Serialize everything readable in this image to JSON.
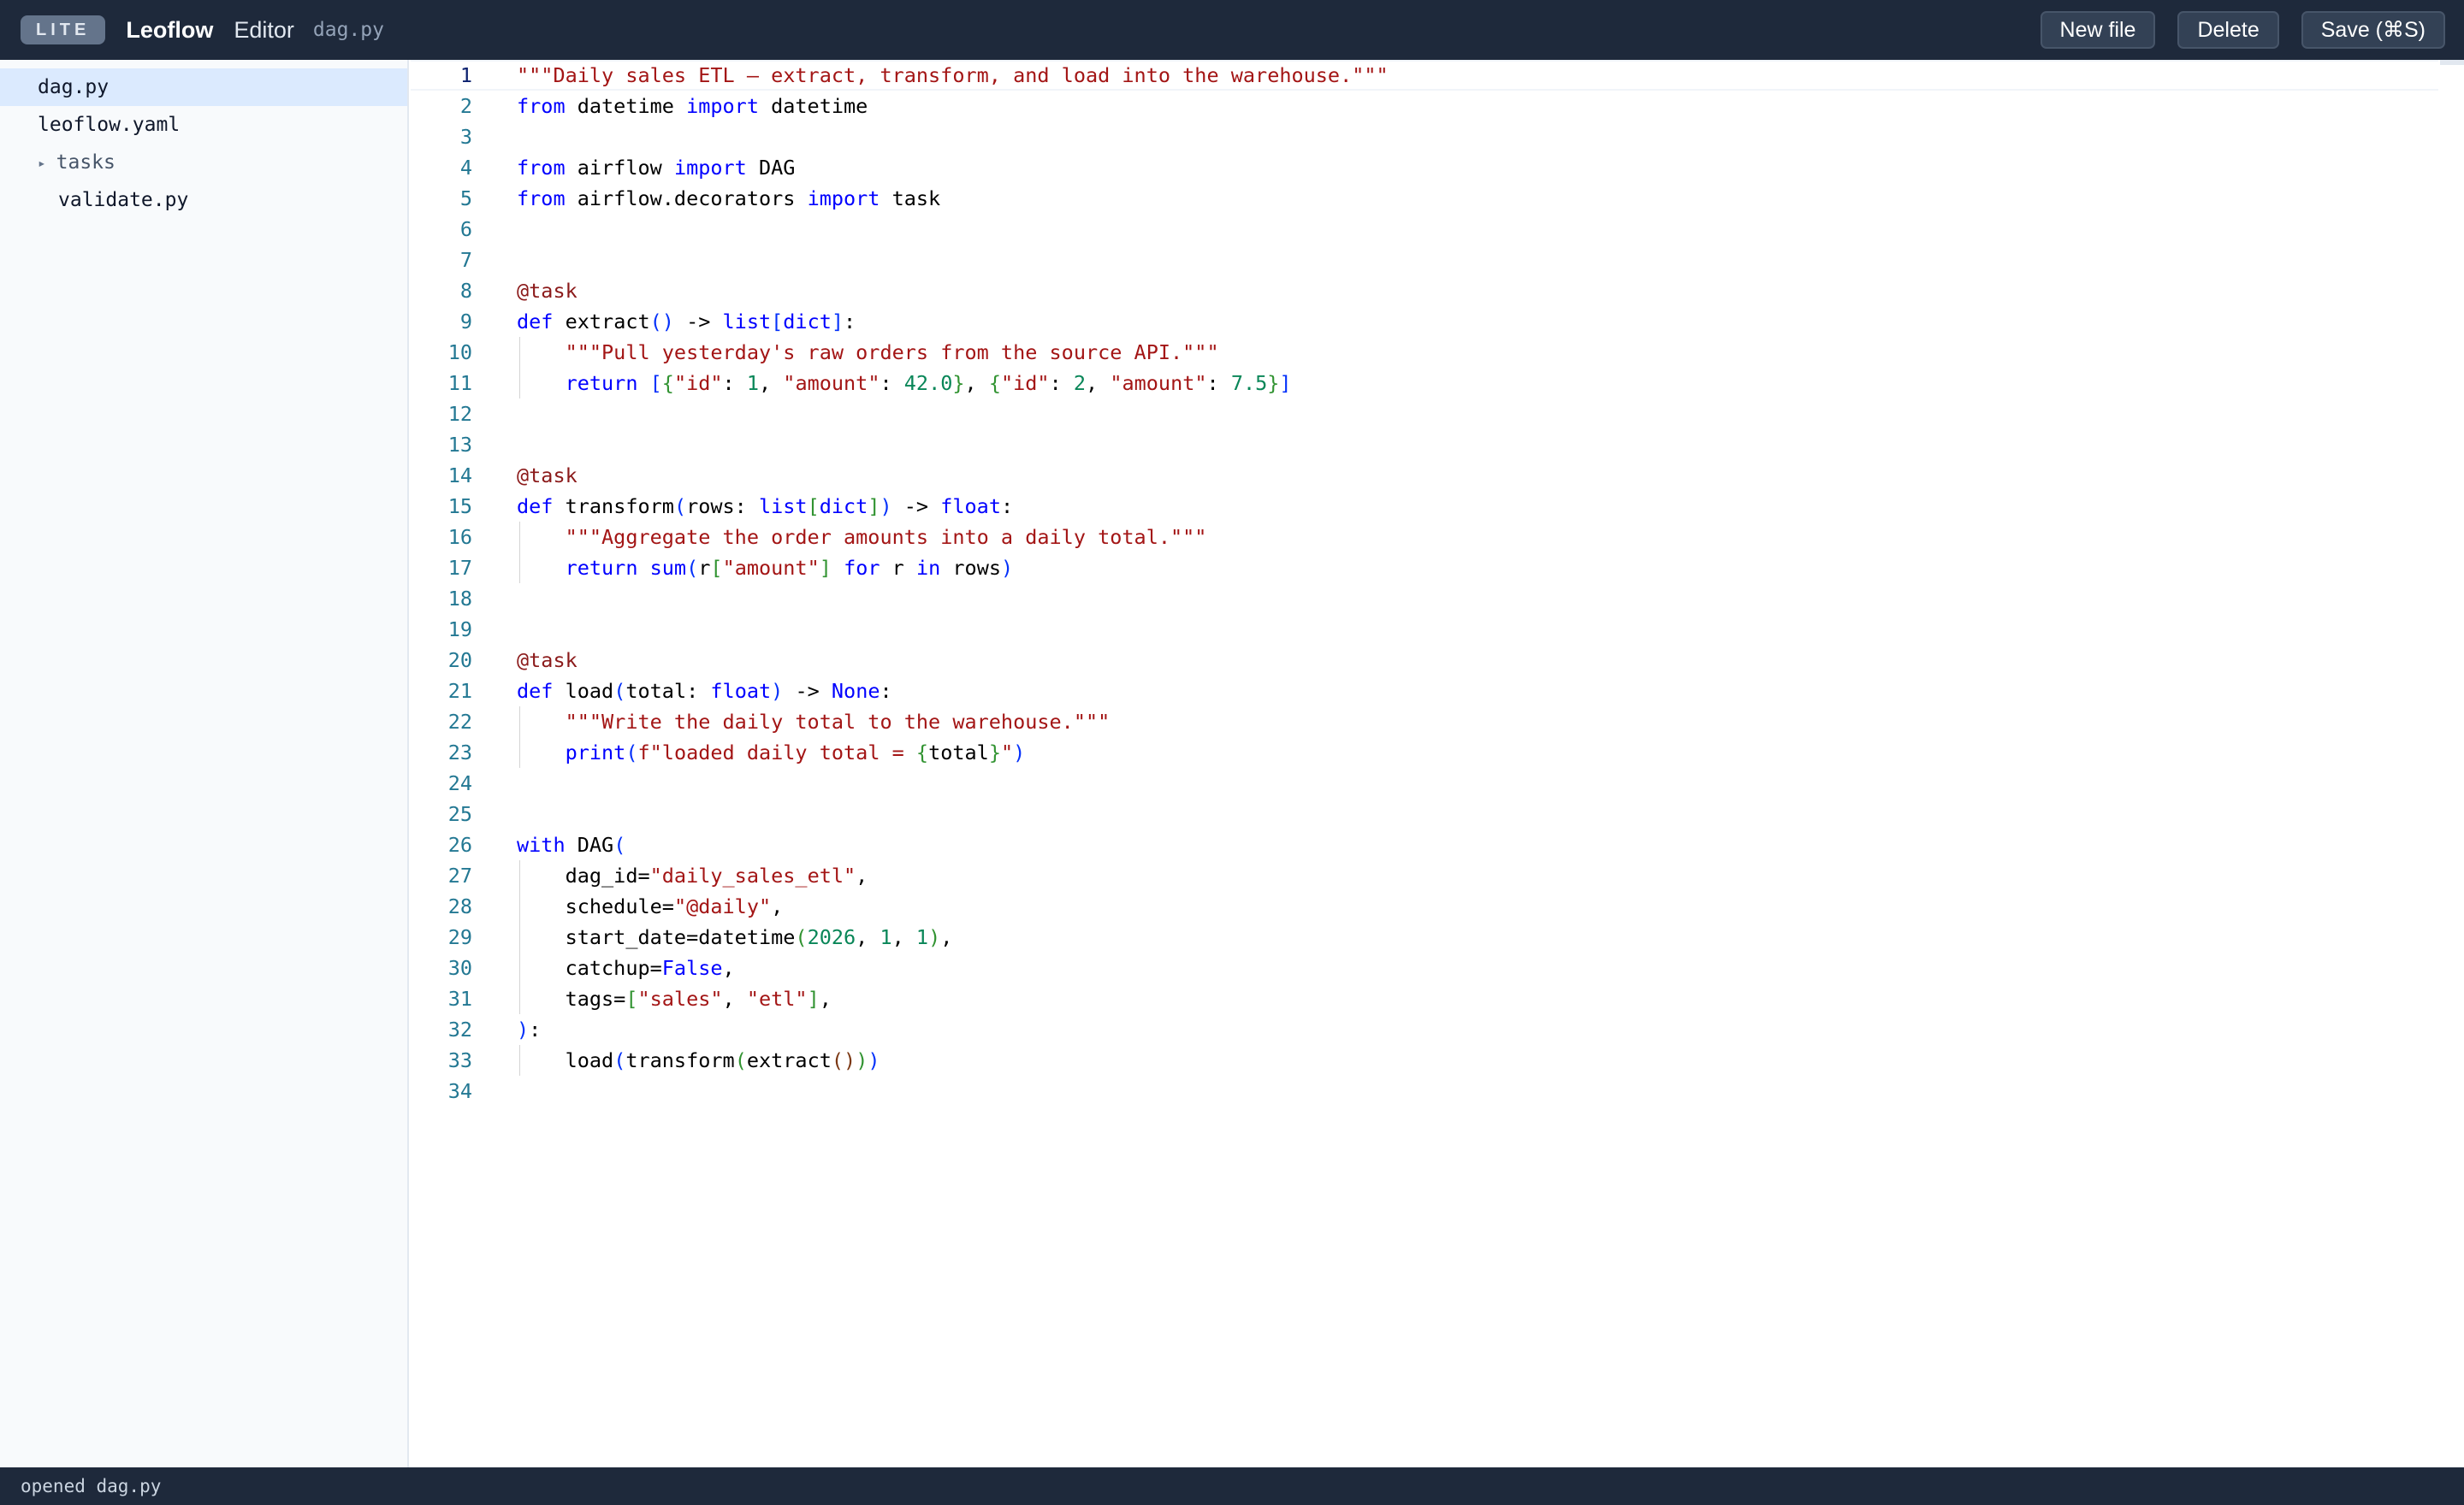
{
  "header": {
    "badge": "LITE",
    "app_name": "Leoflow",
    "section": "Editor",
    "current_file": "dag.py",
    "buttons": {
      "new_file": "New file",
      "delete": "Delete",
      "save": "Save (⌘S)"
    }
  },
  "sidebar": {
    "items": [
      {
        "label": "dag.py",
        "type": "file",
        "active": true,
        "depth": 0
      },
      {
        "label": "leoflow.yaml",
        "type": "file",
        "active": false,
        "depth": 0
      },
      {
        "label": "tasks",
        "type": "folder",
        "active": false,
        "depth": 0,
        "icon": "caret-right-icon"
      },
      {
        "label": "validate.py",
        "type": "file",
        "active": false,
        "depth": 1
      }
    ]
  },
  "editor": {
    "active_line": 1,
    "lines": [
      [
        [
          "str",
          "\"\"\"Daily sales ETL — extract, transform, and load into the warehouse.\"\"\""
        ]
      ],
      [
        [
          "kw",
          "from"
        ],
        [
          "p",
          " datetime "
        ],
        [
          "kw",
          "import"
        ],
        [
          "p",
          " datetime"
        ]
      ],
      [],
      [
        [
          "kw",
          "from"
        ],
        [
          "p",
          " airflow "
        ],
        [
          "kw",
          "import"
        ],
        [
          "p",
          " DAG"
        ]
      ],
      [
        [
          "kw",
          "from"
        ],
        [
          "p",
          " airflow.decorators "
        ],
        [
          "kw",
          "import"
        ],
        [
          "p",
          " task"
        ]
      ],
      [],
      [],
      [
        [
          "dec",
          "@task"
        ]
      ],
      [
        [
          "kw",
          "def"
        ],
        [
          "p",
          " extract"
        ],
        [
          "b1",
          "()"
        ],
        [
          "p",
          " -> "
        ],
        [
          "kw",
          "list"
        ],
        [
          "b1",
          "["
        ],
        [
          "kw",
          "dict"
        ],
        [
          "b1",
          "]"
        ],
        [
          "p",
          ":"
        ]
      ],
      [
        [
          "p",
          "    "
        ],
        [
          "str",
          "\"\"\"Pull yesterday's raw orders from the source API.\"\"\""
        ]
      ],
      [
        [
          "p",
          "    "
        ],
        [
          "kw",
          "return"
        ],
        [
          "p",
          " "
        ],
        [
          "b1",
          "["
        ],
        [
          "b2",
          "{"
        ],
        [
          "str",
          "\"id\""
        ],
        [
          "p",
          ": "
        ],
        [
          "num",
          "1"
        ],
        [
          "p",
          ", "
        ],
        [
          "str",
          "\"amount\""
        ],
        [
          "p",
          ": "
        ],
        [
          "num",
          "42.0"
        ],
        [
          "b2",
          "}"
        ],
        [
          "p",
          ", "
        ],
        [
          "b2",
          "{"
        ],
        [
          "str",
          "\"id\""
        ],
        [
          "p",
          ": "
        ],
        [
          "num",
          "2"
        ],
        [
          "p",
          ", "
        ],
        [
          "str",
          "\"amount\""
        ],
        [
          "p",
          ": "
        ],
        [
          "num",
          "7.5"
        ],
        [
          "b2",
          "}"
        ],
        [
          "b1",
          "]"
        ]
      ],
      [],
      [],
      [
        [
          "dec",
          "@task"
        ]
      ],
      [
        [
          "kw",
          "def"
        ],
        [
          "p",
          " transform"
        ],
        [
          "b1",
          "("
        ],
        [
          "p",
          "rows: "
        ],
        [
          "kw",
          "list"
        ],
        [
          "b2",
          "["
        ],
        [
          "kw",
          "dict"
        ],
        [
          "b2",
          "]"
        ],
        [
          "b1",
          ")"
        ],
        [
          "p",
          " -> "
        ],
        [
          "kw",
          "float"
        ],
        [
          "p",
          ":"
        ]
      ],
      [
        [
          "p",
          "    "
        ],
        [
          "str",
          "\"\"\"Aggregate the order amounts into a daily total.\"\"\""
        ]
      ],
      [
        [
          "p",
          "    "
        ],
        [
          "kw",
          "return"
        ],
        [
          "p",
          " "
        ],
        [
          "kw",
          "sum"
        ],
        [
          "b1",
          "("
        ],
        [
          "p",
          "r"
        ],
        [
          "b2",
          "["
        ],
        [
          "str",
          "\"amount\""
        ],
        [
          "b2",
          "]"
        ],
        [
          "p",
          " "
        ],
        [
          "kw",
          "for"
        ],
        [
          "p",
          " r "
        ],
        [
          "kw",
          "in"
        ],
        [
          "p",
          " rows"
        ],
        [
          "b1",
          ")"
        ]
      ],
      [],
      [],
      [
        [
          "dec",
          "@task"
        ]
      ],
      [
        [
          "kw",
          "def"
        ],
        [
          "p",
          " load"
        ],
        [
          "b1",
          "("
        ],
        [
          "p",
          "total: "
        ],
        [
          "kw",
          "float"
        ],
        [
          "b1",
          ")"
        ],
        [
          "p",
          " -> "
        ],
        [
          "kw",
          "None"
        ],
        [
          "p",
          ":"
        ]
      ],
      [
        [
          "p",
          "    "
        ],
        [
          "str",
          "\"\"\"Write the daily total to the warehouse.\"\"\""
        ]
      ],
      [
        [
          "p",
          "    "
        ],
        [
          "kw",
          "print"
        ],
        [
          "b1",
          "("
        ],
        [
          "str",
          "f\"loaded daily total = "
        ],
        [
          "b2",
          "{"
        ],
        [
          "p",
          "total"
        ],
        [
          "b2",
          "}"
        ],
        [
          "str",
          "\""
        ],
        [
          "b1",
          ")"
        ]
      ],
      [],
      [],
      [
        [
          "kw",
          "with"
        ],
        [
          "p",
          " DAG"
        ],
        [
          "b1",
          "("
        ]
      ],
      [
        [
          "p",
          "    dag_id="
        ],
        [
          "str",
          "\"daily_sales_etl\""
        ],
        [
          "p",
          ","
        ]
      ],
      [
        [
          "p",
          "    schedule="
        ],
        [
          "str",
          "\"@daily\""
        ],
        [
          "p",
          ","
        ]
      ],
      [
        [
          "p",
          "    start_date=datetime"
        ],
        [
          "b2",
          "("
        ],
        [
          "num",
          "2026"
        ],
        [
          "p",
          ", "
        ],
        [
          "num",
          "1"
        ],
        [
          "p",
          ", "
        ],
        [
          "num",
          "1"
        ],
        [
          "b2",
          ")"
        ],
        [
          "p",
          ","
        ]
      ],
      [
        [
          "p",
          "    catchup="
        ],
        [
          "kw",
          "False"
        ],
        [
          "p",
          ","
        ]
      ],
      [
        [
          "p",
          "    tags="
        ],
        [
          "b2",
          "["
        ],
        [
          "str",
          "\"sales\""
        ],
        [
          "p",
          ", "
        ],
        [
          "str",
          "\"etl\""
        ],
        [
          "b2",
          "]"
        ],
        [
          "p",
          ","
        ]
      ],
      [
        [
          "b1",
          ")"
        ],
        [
          "p",
          ":"
        ]
      ],
      [
        [
          "p",
          "    load"
        ],
        [
          "b1",
          "("
        ],
        [
          "p",
          "transform"
        ],
        [
          "b2",
          "("
        ],
        [
          "p",
          "extract"
        ],
        [
          "b3",
          "()"
        ],
        [
          "b2",
          ")"
        ],
        [
          "b1",
          ")"
        ]
      ],
      []
    ]
  },
  "status": {
    "message": "opened dag.py"
  }
}
